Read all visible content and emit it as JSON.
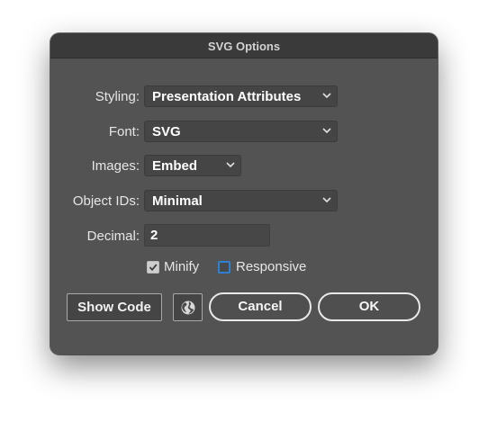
{
  "dialog": {
    "title": "SVG Options"
  },
  "styling": {
    "label": "Styling:",
    "value": "Presentation Attributes"
  },
  "font": {
    "label": "Font:",
    "value": "SVG"
  },
  "images": {
    "label": "Images:",
    "value": "Embed"
  },
  "object_ids": {
    "label": "Object IDs:",
    "value": "Minimal"
  },
  "decimal": {
    "label": "Decimal:",
    "value": "2"
  },
  "minify": {
    "label": "Minify",
    "checked": true
  },
  "responsive": {
    "label": "Responsive",
    "checked": false
  },
  "buttons": {
    "show_code": "Show Code",
    "web_icon": "globe-icon",
    "cancel": "Cancel",
    "ok": "OK"
  },
  "colors": {
    "dialog_bg": "#535353",
    "title_bar": "#3a3a3a",
    "field_bg": "#454545",
    "checkbox_focus": "#2f7fd3"
  }
}
